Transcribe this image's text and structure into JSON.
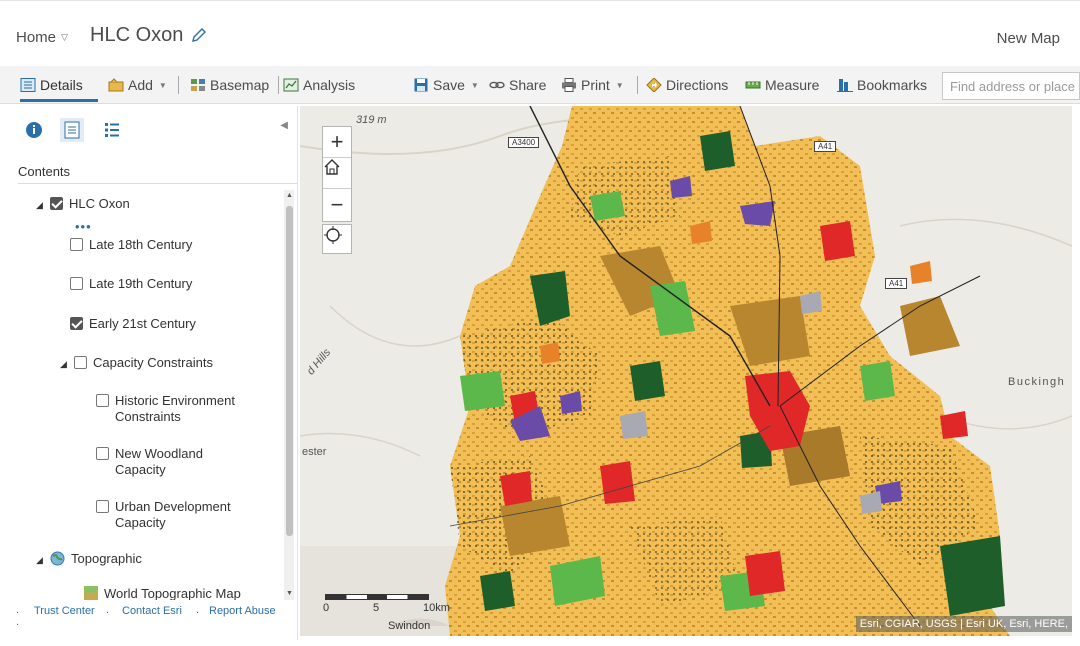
{
  "header": {
    "home_label": "Home",
    "map_title": "HLC Oxon",
    "new_map_label": "New Map"
  },
  "toolbar": {
    "details": "Details",
    "add": "Add",
    "basemap": "Basemap",
    "analysis": "Analysis",
    "save": "Save",
    "share": "Share",
    "print": "Print",
    "directions": "Directions",
    "measure": "Measure",
    "bookmarks": "Bookmarks",
    "search_placeholder": "Find address or place"
  },
  "panel": {
    "contents_label": "Contents",
    "layers": [
      {
        "label": "HLC Oxon",
        "checked": true
      },
      {
        "label": "Late 18th Century",
        "checked": false
      },
      {
        "label": "Late 19th Century",
        "checked": false
      },
      {
        "label": "Early 21st Century",
        "checked": true
      },
      {
        "label": "Capacity Constraints",
        "checked": false
      },
      {
        "label": "Historic Environment Constraints",
        "checked": false
      },
      {
        "label": "New Woodland Capacity",
        "checked": false
      },
      {
        "label": "Urban Development Capacity",
        "checked": false
      },
      {
        "label": "Topographic"
      },
      {
        "label": "World Topographic Map"
      }
    ],
    "footer": {
      "trust": "Trust Center",
      "contact": "Contact Esri",
      "report": "Report Abuse"
    }
  },
  "map": {
    "labels": {
      "elev": "319 m",
      "hills": "d Hills",
      "ester": "ester",
      "buckingham": "Buckingh",
      "swindon": "Swindon",
      "road_a3400": "A3400",
      "road_a41a": "A41",
      "road_a41b": "A41"
    },
    "scale": {
      "s0": "0",
      "s5": "5",
      "s10": "10km"
    },
    "attribution": "Esri, CGIAR, USGS | Esri UK, Esri, HERE,",
    "colors": {
      "yellow": "#f1bf55",
      "brown": "#b8862e",
      "dark_green": "#1e5e2a",
      "green": "#5cb84a",
      "red": "#e02828",
      "purple": "#6a4ca8",
      "orange": "#e8822a",
      "grey": "#a9a9b4"
    }
  }
}
